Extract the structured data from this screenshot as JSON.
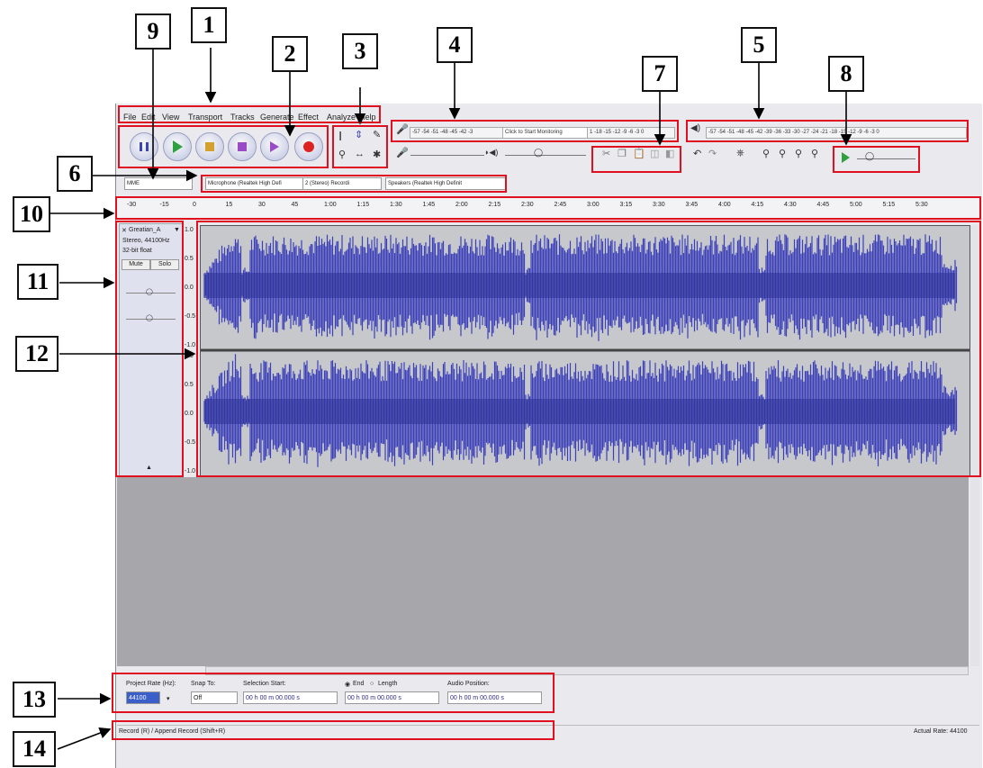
{
  "callouts": [
    "1",
    "2",
    "3",
    "4",
    "5",
    "6",
    "7",
    "8",
    "9",
    "10",
    "11",
    "12",
    "13",
    "14"
  ],
  "menu": {
    "items": [
      "File",
      "Edit",
      "View",
      "Transport",
      "Tracks",
      "Generate",
      "Effect",
      "Analyze",
      "Help"
    ]
  },
  "transport": {
    "buttons": [
      "pause",
      "play",
      "stop",
      "skip-to-start",
      "skip-to-end",
      "record"
    ]
  },
  "meters": {
    "record_scale": "-57 -54 -51 -48 -45 -42 -3",
    "record_monitor": "Click to Start Monitoring",
    "record_scale_tail": "1 -18 -15 -12 -9 -6 -3 0",
    "play_scale": "-57 -54 -51 -48 -45 -42 -39 -36 -33 -30 -27 -24 -21 -18 -15 -12 -9 -6 -3 0"
  },
  "device": {
    "host": "MME",
    "mic": "Microphone (Realtek High Defi",
    "channels": "2 (Stereo) Recordi",
    "speakers": "Speakers (Realtek High Definit"
  },
  "ruler": {
    "labels": [
      "-30",
      "-15",
      "0",
      "15",
      "30",
      "45",
      "1:00",
      "1:15",
      "1:30",
      "1:45",
      "2:00",
      "2:15",
      "2:30",
      "2:45",
      "3:00",
      "3:15",
      "3:30",
      "3:45",
      "4:00",
      "4:15",
      "4:30",
      "4:45",
      "5:00",
      "5:15",
      "5:30"
    ]
  },
  "track": {
    "name": "Greatian_A",
    "info1": "Stereo, 44100Hz",
    "info2": "32-bit float",
    "mute": "Mute",
    "solo": "Solo",
    "scale": [
      "1.0",
      "0.5",
      "0.0",
      "-0.5",
      "-1.0"
    ]
  },
  "selection": {
    "project_rate_label": "Project Rate (Hz):",
    "project_rate": "44100",
    "snap_label": "Snap To:",
    "snap_value": "Off",
    "sel_start_label": "Selection Start:",
    "end_label": "End",
    "length_label": "Length",
    "audio_pos_label": "Audio Position:",
    "time1": "00 h 00 m 00.000 s",
    "time2": "00 h 00 m 00.000 s",
    "time3": "00 h 00 m 00.000 s"
  },
  "status": {
    "left": "Record (R) / Append Record (Shift+R)",
    "right": "Actual Rate: 44100"
  },
  "colors": {
    "waveform": "#3b3fb8",
    "annotation_red": "#e01020"
  }
}
